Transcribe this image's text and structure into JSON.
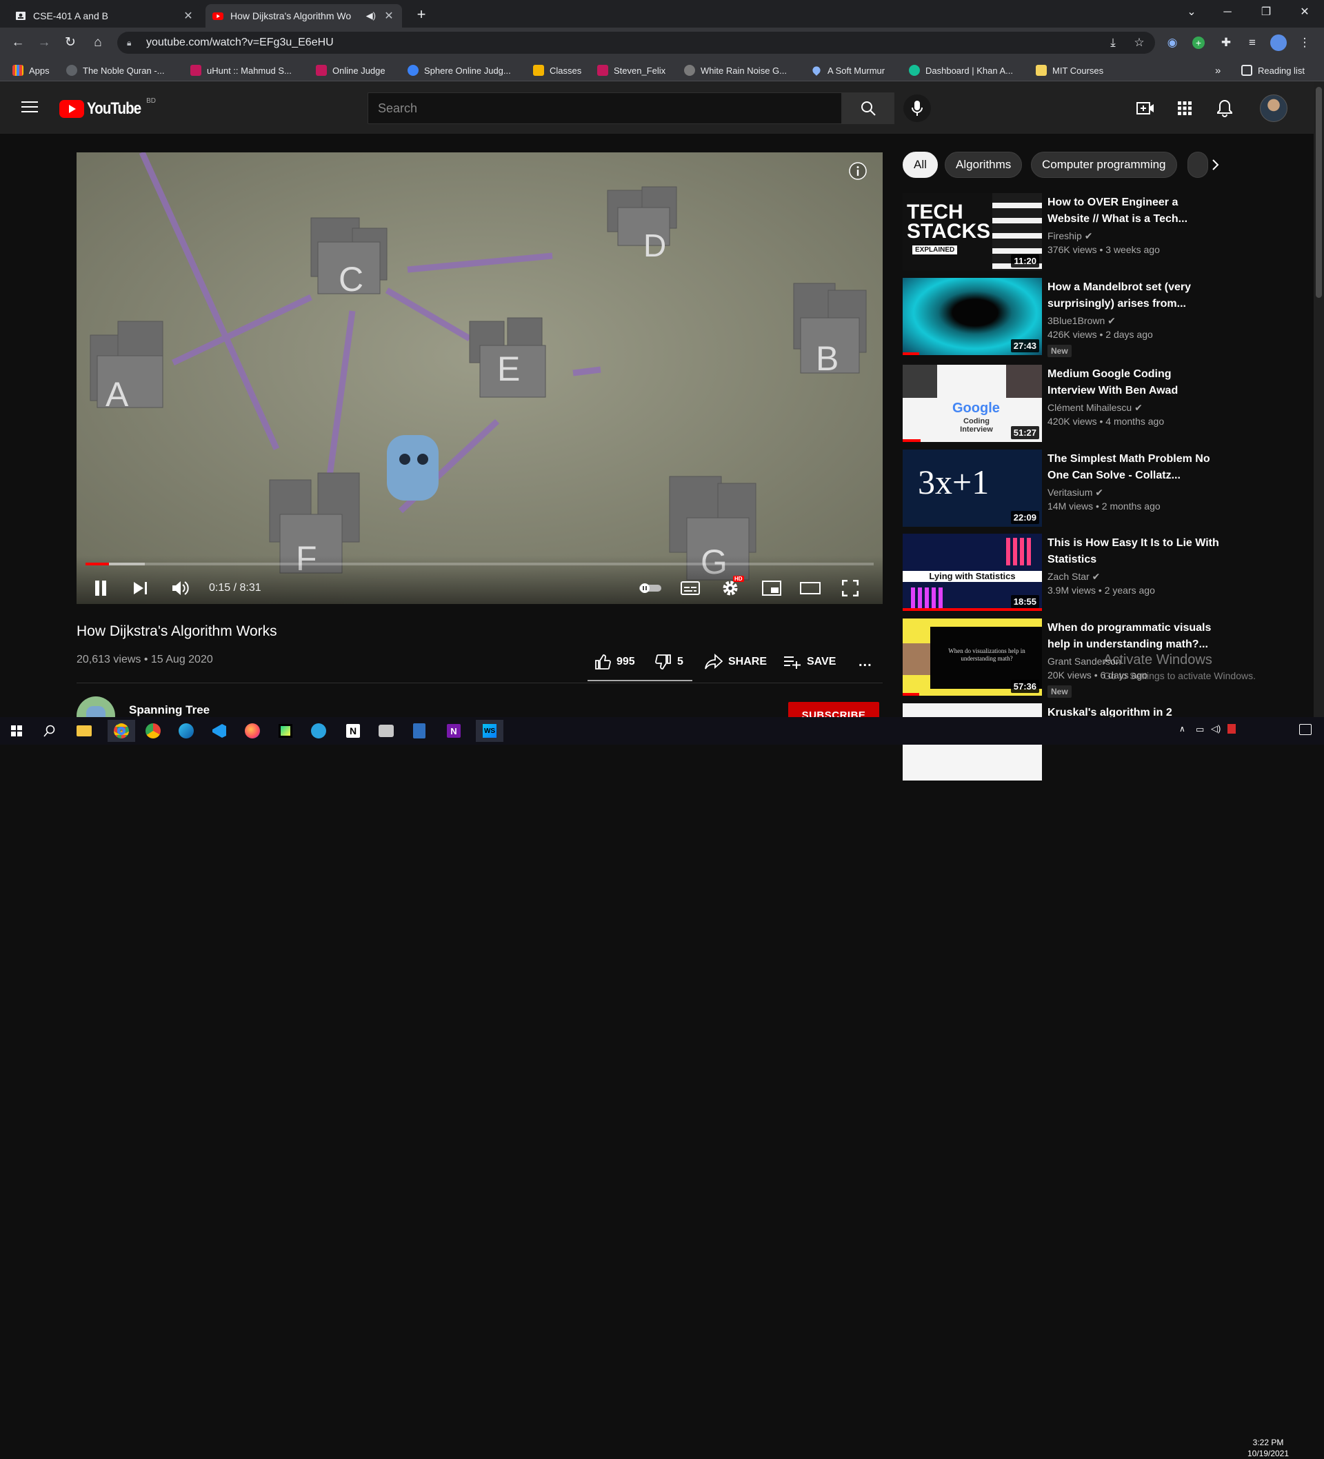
{
  "browser": {
    "tabs": [
      {
        "title": "CSE-401 A and B",
        "active": false
      },
      {
        "title": "How Dijkstra's Algorithm Wo",
        "active": true
      }
    ],
    "url": "youtube.com/watch?v=EFg3u_E6eHU",
    "reading_list": "Reading list",
    "bookmarks": [
      "Apps",
      "The Noble Quran -...",
      "uHunt :: Mahmud S...",
      "Online Judge",
      "Sphere Online Judg...",
      "Classes",
      "Steven_Felix",
      "White Rain Noise G...",
      "A Soft Murmur",
      "Dashboard | Khan A...",
      "MIT Courses"
    ],
    "bookmark_overflow": "»"
  },
  "youtube": {
    "logo_text": "YouTube",
    "region": "BD",
    "search_placeholder": "Search"
  },
  "player": {
    "scene_labels": [
      "A",
      "B",
      "C",
      "D",
      "E",
      "F",
      "G"
    ],
    "timecode": "0:15 / 8:31",
    "played_fraction": 0.03,
    "buffered_fraction": 0.075,
    "hd_badge": "HD"
  },
  "video": {
    "title": "How Dijkstra's Algorithm Works",
    "meta": "20,613 views • 15 Aug 2020",
    "likes": "995",
    "dislikes": "5",
    "share": "SHARE",
    "save": "SAVE",
    "more": "...",
    "channel": "Spanning Tree",
    "subscribe": "SUBSCRIBE"
  },
  "chips": [
    "All",
    "Algorithms",
    "Computer programming"
  ],
  "recommendations": [
    {
      "title": "How to OVER Engineer a Website // What is a Tech...",
      "channel": "Fireship",
      "views": "376K views • 3 weeks ago",
      "duration": "11:20",
      "badge": "",
      "thumb_text": "TECH STACKS",
      "thumb_sub": "EXPLAINED"
    },
    {
      "title": "How a Mandelbrot set (very surprisingly) arises from...",
      "channel": "3Blue1Brown",
      "views": "426K views • 2 days ago",
      "duration": "27:43",
      "badge": "New",
      "thumb_text": "",
      "thumb_sub": ""
    },
    {
      "title": "Medium Google Coding Interview With Ben Awad",
      "channel": "Clément Mihailescu",
      "views": "420K views • 4 months ago",
      "duration": "51:27",
      "badge": "",
      "thumb_text": "Google",
      "thumb_sub": "Coding Interview"
    },
    {
      "title": "The Simplest Math Problem No One Can Solve - Collatz...",
      "channel": "Veritasium",
      "views": "14M views • 2 months ago",
      "duration": "22:09",
      "badge": "",
      "thumb_text": "3x+1",
      "thumb_sub": ""
    },
    {
      "title": "This is How Easy It Is to Lie With Statistics",
      "channel": "Zach Star",
      "views": "3.9M views • 2 years ago",
      "duration": "18:55",
      "badge": "",
      "thumb_text": "Lying with Statistics",
      "thumb_sub": ""
    },
    {
      "title": "When do programmatic visuals help in understanding math?...",
      "channel": "Grant Sanderson",
      "views": "20K views • 6 days ago",
      "duration": "57:36",
      "badge": "New",
      "thumb_text": "When do visualizations help in understanding math?",
      "thumb_sub": ""
    },
    {
      "title": "Kruskal's algorithm in 2",
      "channel": "",
      "views": "",
      "duration": "",
      "badge": "",
      "thumb_text": "",
      "thumb_sub": ""
    }
  ],
  "watermark": {
    "title": "Activate Windows",
    "subtitle": "Go to Settings to activate Windows."
  },
  "taskbar": {
    "time": "3:22 PM",
    "date": "10/19/2021"
  }
}
